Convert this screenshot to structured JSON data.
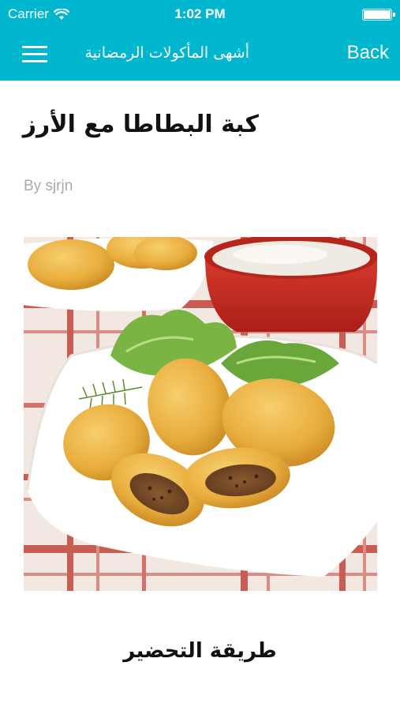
{
  "status_bar": {
    "carrier": "Carrier",
    "time": "1:02 PM",
    "icons": [
      "wifi-icon",
      "battery-icon"
    ]
  },
  "nav_bar": {
    "title": "أشهى المأكولات الرمضانية",
    "back_label": "Back",
    "menu_icon": "hamburger-menu-icon",
    "background_color": "#00b7cf",
    "text_color": "#ffffff"
  },
  "article": {
    "title": "كبة البطاطا مع الأرز",
    "author": "By sjrjn",
    "image": "food-photo",
    "section_heading": "طريقة التحضير"
  }
}
